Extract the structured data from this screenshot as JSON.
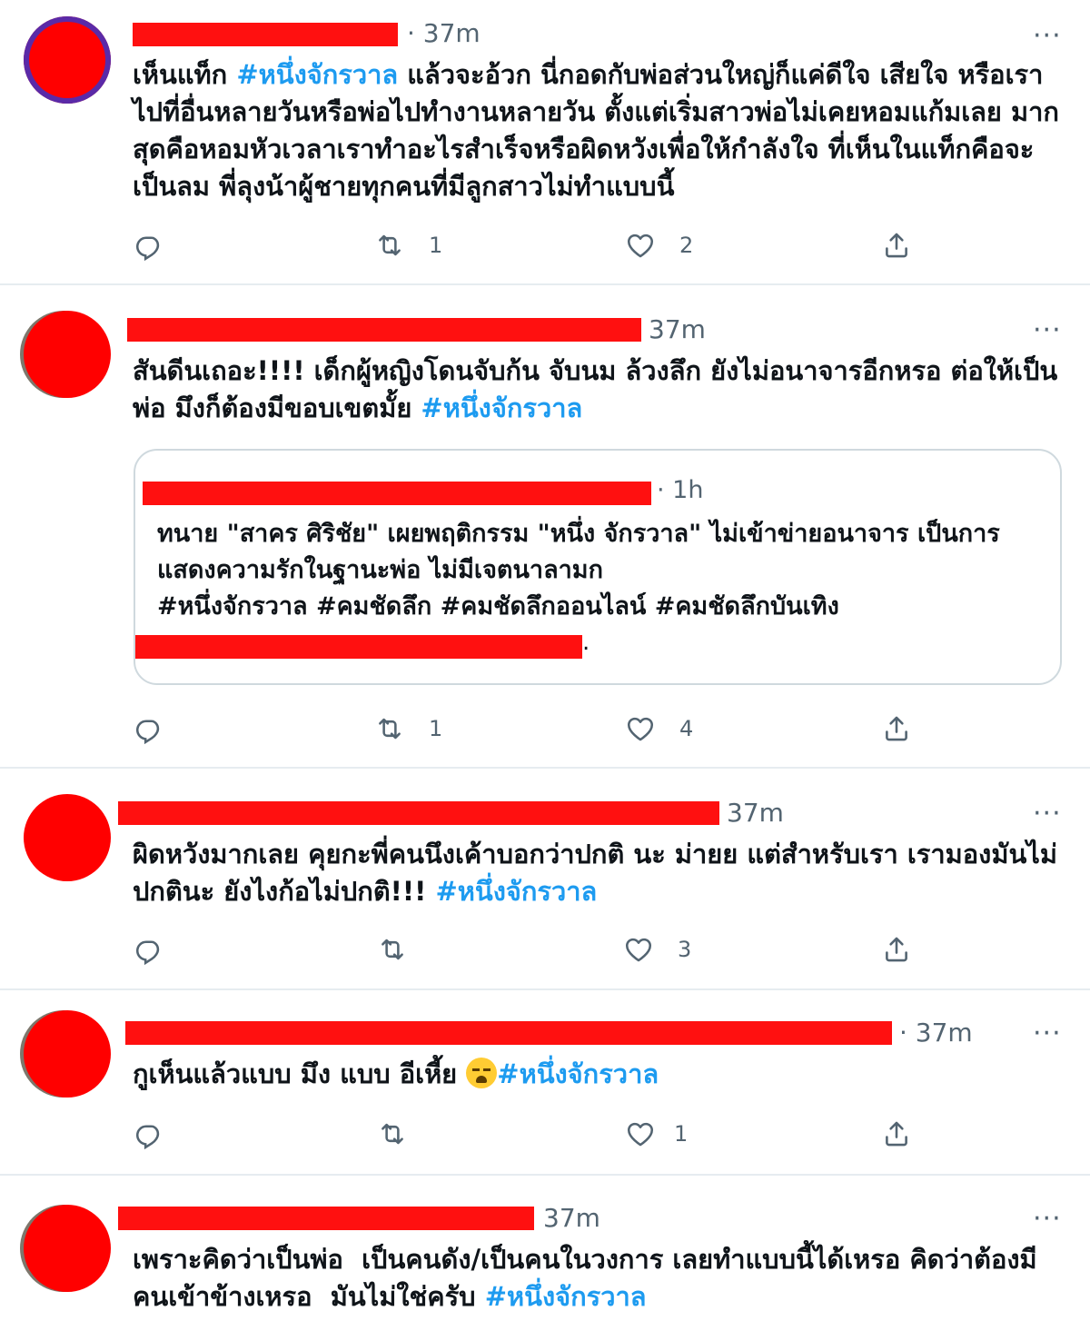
{
  "colors": {
    "accent": "#1d9bf0",
    "muted": "#536471",
    "divider": "#e6ecf0",
    "redaction": "#ff0000"
  },
  "icons": {
    "reply": "reply-icon",
    "retweet": "retweet-icon",
    "like": "heart-icon",
    "share": "share-icon",
    "more": "more-icon"
  },
  "tweets": [
    {
      "time": "· 37m",
      "text_plain": "เห็นแท็ก ",
      "hashtag": "#หนึ่งจักรวาล",
      "text_after": " แล้วจะอ้วก นี่กอดกับพ่อส่วนใหญ่ก็แค่ดีใจ เสียใจ หรือเราไปที่อื่นหลายวันหรือพ่อไปทำงานหลายวัน ตั้งแต่เริ่มสาวพ่อไม่เคยหอมแก้มเลย มากสุดคือหอมหัวเวลาเราทำอะไรสำเร็จหรือผิดหวังเพื่อให้กำลังใจ ที่เห็นในแท็กคือจะเป็นลม พี่ลุงน้าผู้ชายทุกคนที่มีลูกสาวไม่ทำแบบนี้",
      "retweets": "1",
      "likes": "2"
    },
    {
      "time": "37m",
      "text_plain": "สันดีนเถอะ!!!! เด็กผู้หญิงโดนจับก้น จับนม ล้วงลึก ยังไม่อนาจารอีกหรอ ต่อให้เป็นพ่อ มึงก็ต้องมีขอบเขตมั้ย ",
      "hashtag": "#หนึ่งจักรวาล",
      "text_after": "",
      "retweets": "1",
      "likes": "4",
      "quote": {
        "time": "· 1h",
        "text": "ทนาย \"สาคร ศิริชัย\" เผยพฤติกรรม \"หนึ่ง จักรวาล\" ไม่เข้าข่ายอนาจาร เป็นการแสดงความรักในฐานะพ่อ ไม่มีเจตนาลามก",
        "hashtags": "#หนึ่งจักรวาล #คมชัดลึก #คมชัดลึกออนไลน์ #คมชัดลึกบันเทิง",
        "trail": "."
      }
    },
    {
      "time": "37m",
      "text_plain": "ผิดหวังมากเลย คุยกะพี่คนนึงเค้าบอกว่าปกติ นะ ม่ายย แต่สำหรับเรา เรามองมันไม่ปกตินะ ยังไงก้อไม่ปกติ!!! ",
      "hashtag": "#หนึ่งจักรวาล",
      "text_after": "",
      "retweets": "",
      "likes": "3"
    },
    {
      "time": "· 37m",
      "text_plain": "กูเห็นแล้วแบบ มึง แบบ อีเหี้ย ",
      "hashtag": "#หนึ่งจักรวาล",
      "text_after": "",
      "retweets": "",
      "likes": "1"
    },
    {
      "time": "37m",
      "text_plain": "เพราะคิดว่าเป็นพ่อ  เป็นคนดัง/เป็นคนในวงการ เลยทำแบบนี้ได้เหรอ คิดว่าต้องมีคนเข้าข้างเหรอ  มันไม่ใช่ครับ ",
      "hashtag": "#หนึ่งจักรวาล",
      "text_after": ""
    }
  ],
  "more_label": "···"
}
